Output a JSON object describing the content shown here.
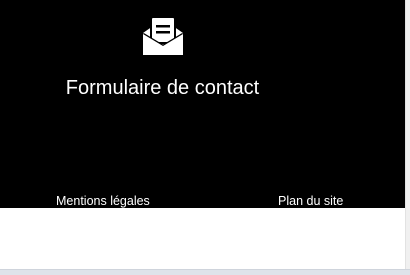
{
  "contact": {
    "icon": "envelope-open-letter-icon",
    "title": "Formulaire de contact"
  },
  "footer_links": {
    "legal": "Mentions légales",
    "sitemap": "Plan du site"
  },
  "colors": {
    "footer_background": "#000000",
    "text": "#ffffff",
    "page_background": "#ffffff"
  }
}
